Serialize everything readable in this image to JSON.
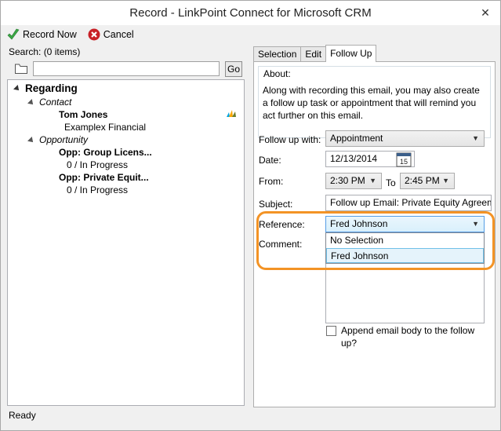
{
  "window": {
    "title": "Record - LinkPoint Connect for Microsoft CRM",
    "close_glyph": "✕"
  },
  "toolbar": {
    "record_now": "Record Now",
    "cancel": "Cancel"
  },
  "search": {
    "label": "Search: (0 items)",
    "value": "",
    "go": "Go"
  },
  "tree": {
    "regarding": "Regarding",
    "contact": "Contact",
    "contact_name": "Tom Jones",
    "contact_company": "Examplex Financial",
    "opportunity": "Opportunity",
    "opp1_name": "Opp: Group Licens...",
    "opp1_status": "0 / In Progress",
    "opp2_name": "Opp: Private Equit...",
    "opp2_status": "0 / In Progress"
  },
  "status_bar": {
    "text": "Ready"
  },
  "tabs": [
    {
      "label": "Selection"
    },
    {
      "label": "Edit"
    },
    {
      "label": "Follow Up"
    }
  ],
  "follow_up": {
    "about_title": "About:",
    "about_text": "Along with recording this email, you may also create a follow up task or appointment that will remind you act further on this email.",
    "follow_up_with_label": "Follow up with:",
    "follow_up_with_value": "Appointment",
    "date_label": "Date:",
    "date_value": "12/13/2014",
    "calendar_day": "15",
    "from_label": "From:",
    "from_value": "2:30 PM",
    "to_label": "To",
    "to_value": "2:45 PM",
    "subject_label": "Subject:",
    "subject_value": "Follow up Email: Private Equity Agreement",
    "reference_label": "Reference:",
    "reference_value": "Fred Johnson",
    "reference_options": [
      "No Selection",
      "Fred Johnson"
    ],
    "comment_label": "Comment:",
    "append_label": "Append email body to the follow up?"
  },
  "colors": {
    "highlight": "#f39325",
    "record_icon": "#3aa845",
    "cancel_icon": "#c82127"
  },
  "icons": {
    "record": "checkmark-icon",
    "cancel": "cancel-icon",
    "folder": "folder-icon",
    "crm": "dynamics-crm-icon",
    "calendar": "calendar-icon"
  }
}
